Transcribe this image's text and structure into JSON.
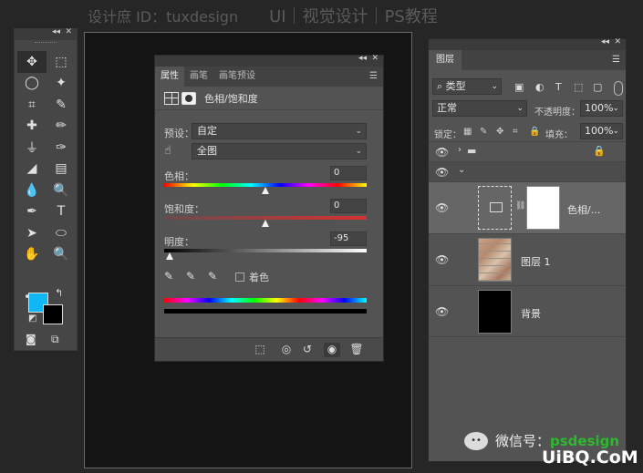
{
  "watermark_top": {
    "left": "设计庶 ID：tuxdesign",
    "right": "UI｜视觉设计｜PS教程"
  },
  "tools": {
    "collapse": "◂◂",
    "close": "✕",
    "icons": [
      "move-icon",
      "marquee-icon",
      "lasso-icon",
      "magic-wand-icon",
      "crop-icon",
      "eyedropper-icon",
      "healing-icon",
      "brush-icon",
      "stamp-icon",
      "history-brush-icon",
      "eraser-icon",
      "gradient-icon",
      "blur-icon",
      "dodge-icon",
      "pen-icon",
      "type-icon",
      "path-select-icon",
      "ellipse-icon",
      "hand-icon",
      "zoom-icon"
    ],
    "glyphs": [
      "✥",
      "⬚",
      "◯",
      "✦",
      "⌗",
      "✎",
      "✚",
      "✏",
      "⏚",
      "✑",
      "◢",
      "▤",
      "💧",
      "🔍",
      "✒",
      "T",
      "➤",
      "⬭",
      "✋",
      "🔍"
    ],
    "more": "•••",
    "fg_color": "#11b8f5",
    "bg_color": "#000000"
  },
  "properties": {
    "collapse": "◂◂",
    "close": "✕",
    "tabs": [
      "属性",
      "画笔",
      "画笔预设"
    ],
    "active_tab": "属性",
    "title": "色相/饱和度",
    "preset_label": "预设：",
    "preset_value": "自定",
    "channel_value": "全图",
    "hue": {
      "label": "色相：",
      "value": "0",
      "position": 0.5
    },
    "saturation": {
      "label": "饱和度：",
      "value": "0",
      "position": 0.5
    },
    "lightness": {
      "label": "明度：",
      "value": "-95",
      "position": 0.025
    },
    "colorize_label": "着色",
    "footer_icons": [
      "clip-to-layer-icon",
      "view-previous-icon",
      "reset-icon",
      "visibility-icon",
      "delete-icon"
    ]
  },
  "layers": {
    "collapse": "◂◂",
    "close": "✕",
    "tab": "图层",
    "filter_label": "类型",
    "blend_mode": "正常",
    "opacity_label": "不透明度：",
    "opacity_value": "100%",
    "lock_label": "锁定：",
    "fill_label": "填充：",
    "fill_value": "100%",
    "items": [
      {
        "name": "色相/...",
        "type": "adjustment"
      },
      {
        "name": "图层 1",
        "type": "image"
      },
      {
        "name": "背景",
        "type": "background"
      }
    ]
  },
  "watermark_bottom": {
    "wechat": "微信号：",
    "site": "psdesign",
    "brand": "UiBQ.CoM"
  }
}
